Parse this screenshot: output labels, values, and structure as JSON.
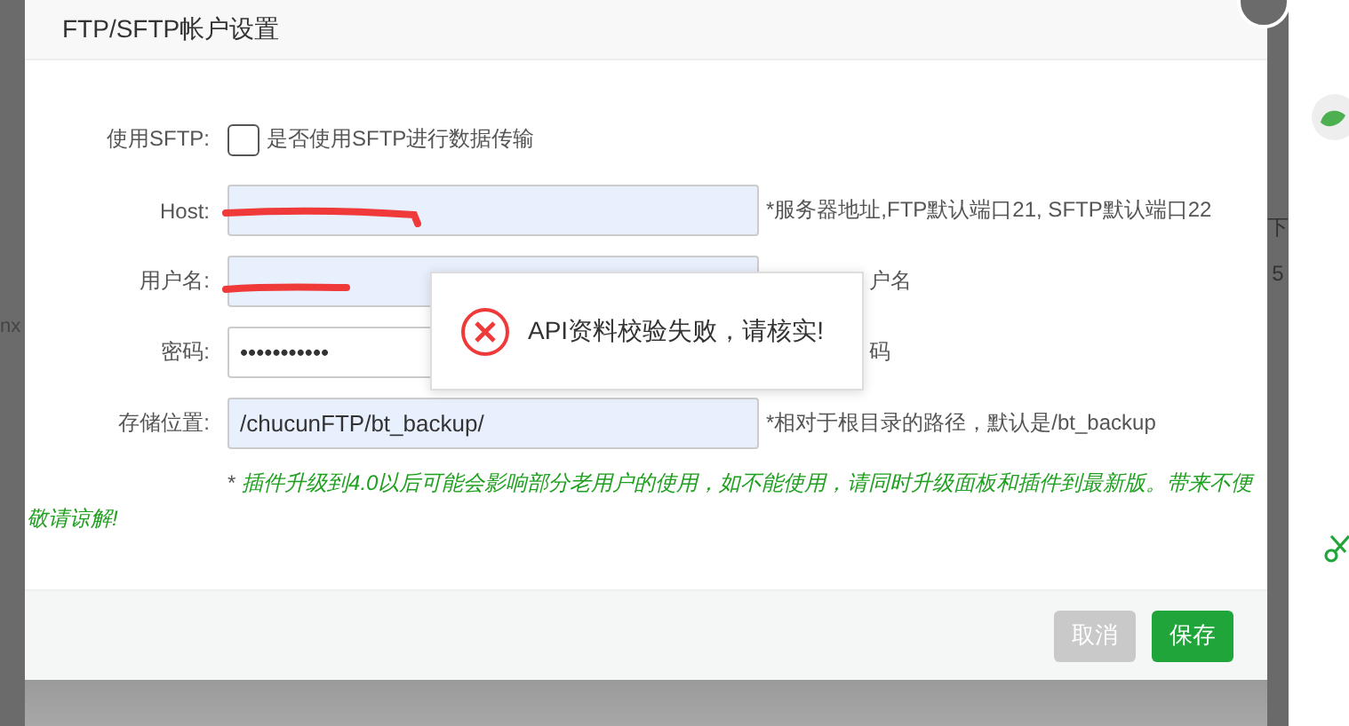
{
  "dialog": {
    "title": "FTP/SFTP帐户设置",
    "fields": [
      {
        "kind": "checkbox",
        "label": "使用SFTP:",
        "checked": false,
        "text": "是否使用SFTP进行数据传输"
      },
      {
        "kind": "text",
        "label": "Host:",
        "redacted": true,
        "hint": "*服务器地址,FTP默认端口21, SFTP默认端口22"
      },
      {
        "kind": "text",
        "label": "用户名:",
        "redacted": true,
        "hint": "户名"
      },
      {
        "kind": "password",
        "label": "密码:",
        "value": "•••••••••••",
        "redacted": false,
        "hint": "码"
      },
      {
        "kind": "text",
        "label": "存储位置:",
        "value": "/chucunFTP/bt_backup/",
        "redacted": false,
        "hint": "*相对于根目录的路径，默认是/bt_backup"
      }
    ],
    "note": {
      "mark": "*",
      "text": "插件升级到4.0以后可能会影响部分老用户的使用，如不能使用，请同时升级面板和插件到最新版。带来不便敬请谅解!"
    },
    "buttons": [
      {
        "label": "取消",
        "kind": "secondary"
      },
      {
        "label": "保存",
        "kind": "primary"
      }
    ]
  },
  "toast": {
    "message": "API资料校验失败，请核实!"
  },
  "background": {
    "left_text": "nx",
    "right_texts": [
      "下",
      "5"
    ]
  }
}
